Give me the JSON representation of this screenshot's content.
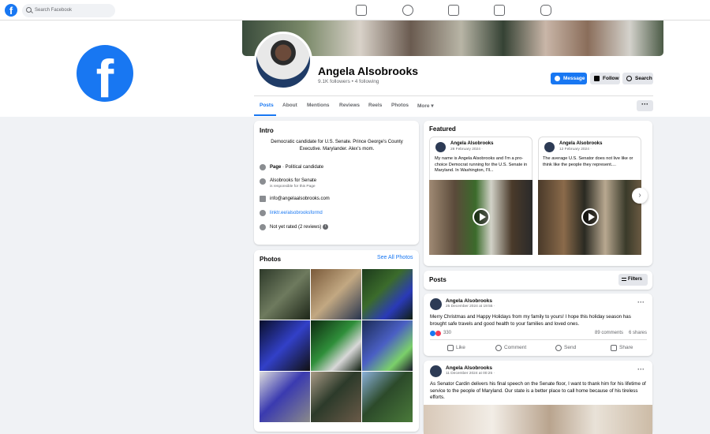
{
  "topbar": {
    "logo_letter": "f",
    "search_placeholder": "Search Facebook",
    "nav_icons": [
      "home-icon",
      "friends-icon",
      "video-icon",
      "marketplace-icon",
      "gaming-icon"
    ]
  },
  "brand_logo_letter": "f",
  "profile": {
    "name": "Angela Alsobrooks",
    "stats": "9.1K followers • 4 following",
    "actions": {
      "message": "Message",
      "follow": "Follow",
      "search": "Search"
    },
    "more_dots": "···"
  },
  "tabs": [
    "Posts",
    "About",
    "Mentions",
    "Reviews",
    "Reels",
    "Photos",
    "More ▾"
  ],
  "intro": {
    "title": "Intro",
    "bio": "Democratic candidate for U.S. Senate. Prince George's County Executive. Marylander. Alex's mom.",
    "page_type_bold": "Page",
    "page_type": " · Political candidate",
    "responsible": "Alsobrooks for Senate",
    "responsible_sub": "is responsible for this Page",
    "email": "info@angelaalsobrooks.com",
    "link": "linktr.ee/alsobrooksformd",
    "rating": "Not yet rated (2 reviews)",
    "rating_info": "i"
  },
  "photos": {
    "title": "Photos",
    "see_all": "See All Photos"
  },
  "featured": {
    "title": "Featured",
    "items": [
      {
        "name": "Angela Alsobrooks",
        "date": "28 February 2024 ·",
        "text": "My name is Angela Alsobrooks and I'm a pro-choice Democrat running for the U.S. Senate in Maryland. In Washington, I'll..."
      },
      {
        "name": "Angela Alsobrooks",
        "date": "12 February 2024 ·",
        "text": "The average U.S. Senator does not live like or think like the people they represent...."
      }
    ],
    "next": "›"
  },
  "posts": {
    "title": "Posts",
    "filters": "Filters",
    "items": [
      {
        "name": "Angela Alsobrooks",
        "date": "25 December 2024 at 19:55 ·",
        "text": "Merry Christmas and Happy Holidays from my family to yours! I hope this holiday season has brought safe travels and good health to your families and loved ones.",
        "reactions": "330",
        "comments": "89 comments",
        "shares": "6 shares",
        "actions": [
          "Like",
          "Comment",
          "Send",
          "Share"
        ]
      },
      {
        "name": "Angela Alsobrooks",
        "date": "11 December 2024 at 00:25 ·",
        "text": "As Senator Cardin delivers his final speech on the Senate floor, I want to thank him for his lifetime of service to the people of Maryland. Our state is a better place to call home because of his tireless efforts."
      }
    ],
    "dots": "···"
  },
  "colors": {
    "accent": "#1877f2",
    "background": "#f0f2f5"
  }
}
